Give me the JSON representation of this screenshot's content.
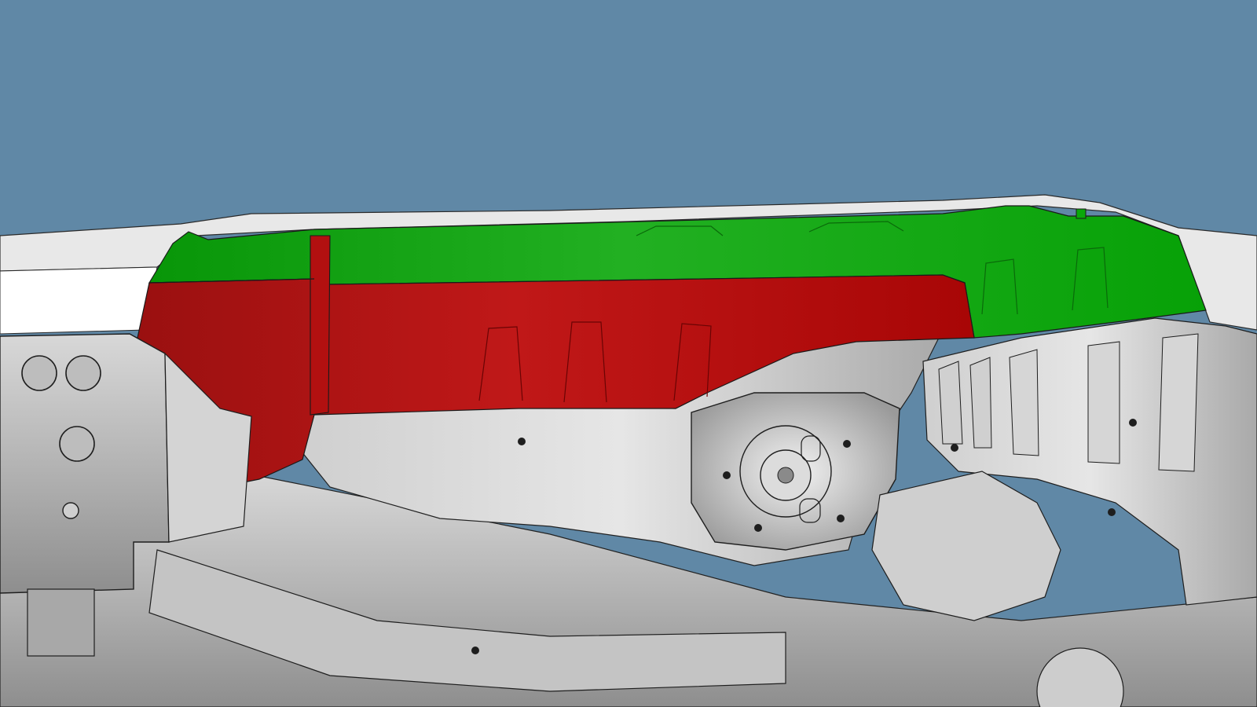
{
  "viewport": {
    "background_color": "#6088a6"
  },
  "model": {
    "highlight_colors": {
      "upper_panel": "#0aa80a",
      "lower_panel": "#b00808",
      "body_gray": "#b9b9b9",
      "edge_line": "#202020"
    },
    "parts": [
      {
        "id": "roof-rail-trim",
        "color_key": "body_gray"
      },
      {
        "id": "upper-green-panel",
        "color_key": "upper_panel"
      },
      {
        "id": "lower-red-panel",
        "color_key": "lower_panel"
      },
      {
        "id": "wheelhouse-inner",
        "color_key": "body_gray"
      },
      {
        "id": "strut-tower",
        "color_key": "body_gray"
      },
      {
        "id": "rear-bulkhead",
        "color_key": "body_gray"
      },
      {
        "id": "floor-frame",
        "color_key": "body_gray"
      },
      {
        "id": "left-pillar-bracket",
        "color_key": "body_gray"
      }
    ]
  }
}
